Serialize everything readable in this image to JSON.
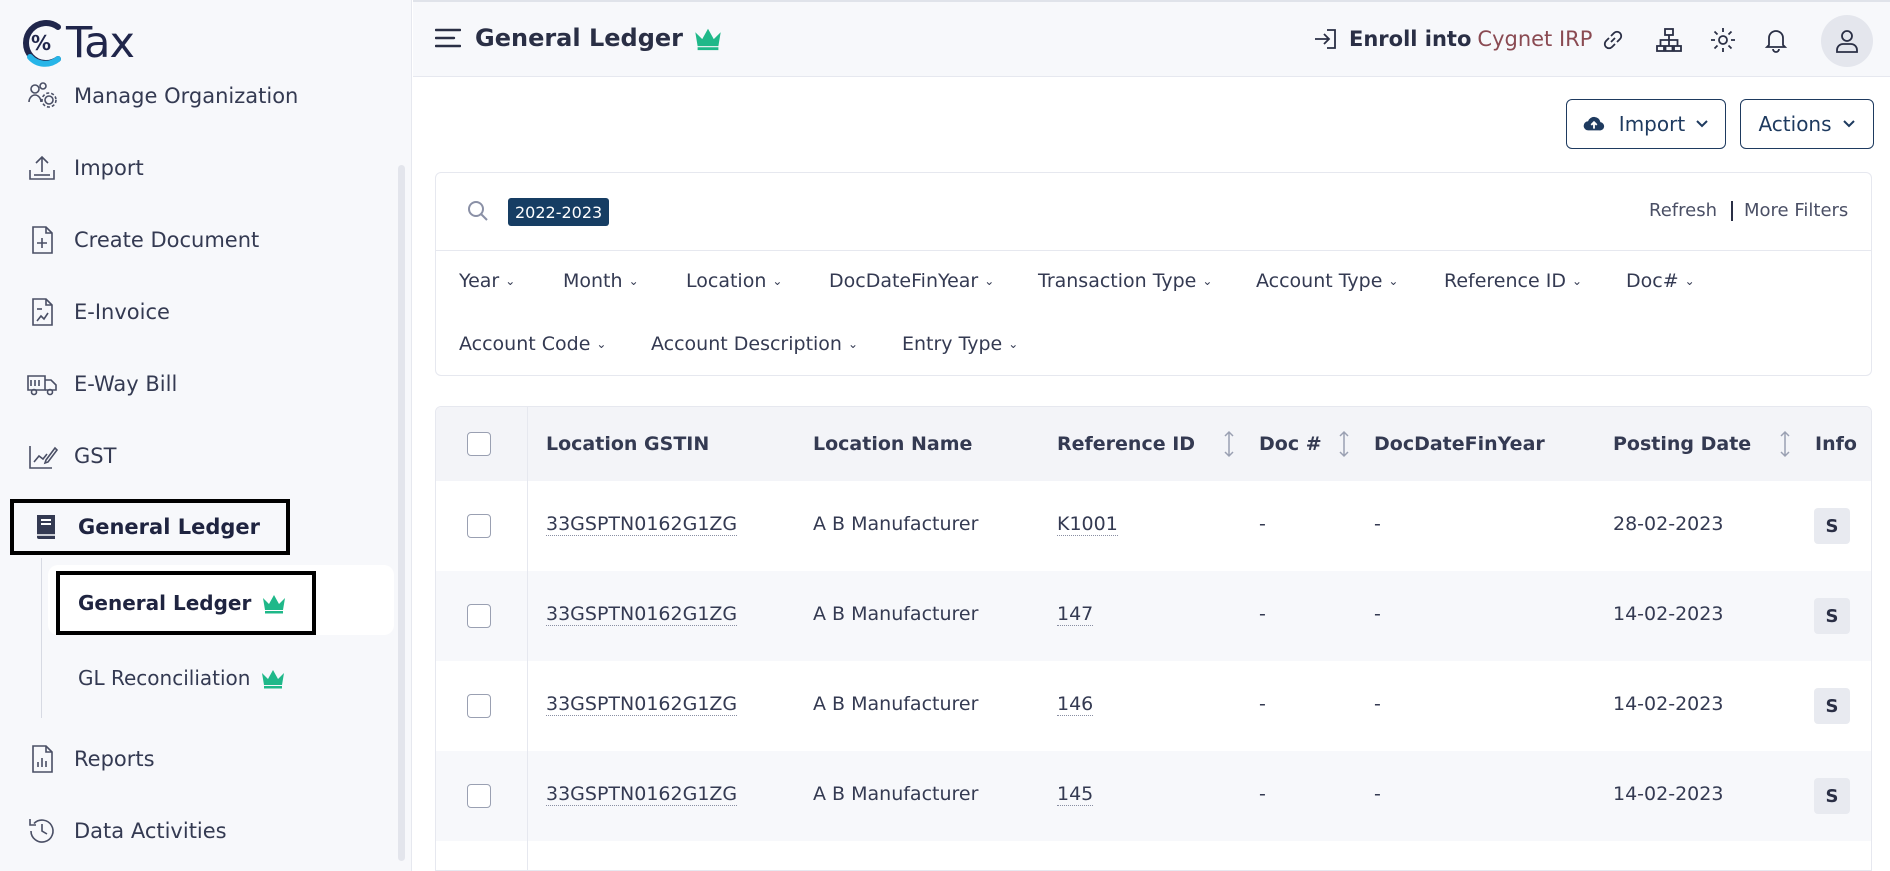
{
  "app": {
    "logo_text": "Tax"
  },
  "sidebar": {
    "items": [
      {
        "label": "Manage Organization",
        "icon": "org-gear-icon"
      },
      {
        "label": "Import",
        "icon": "upload-icon"
      },
      {
        "label": "Create Document",
        "icon": "document-plus-icon"
      },
      {
        "label": "E-Invoice",
        "icon": "invoice-icon"
      },
      {
        "label": "E-Way Bill",
        "icon": "truck-icon"
      },
      {
        "label": "GST",
        "icon": "chart-pen-icon"
      },
      {
        "label": "General Ledger",
        "icon": "book-icon"
      },
      {
        "label": "Reports",
        "icon": "report-icon"
      },
      {
        "label": "Data Activities",
        "icon": "history-icon"
      }
    ],
    "sub_items": [
      {
        "label": "General Ledger",
        "premium": true
      },
      {
        "label": "GL Reconciliation",
        "premium": true
      }
    ]
  },
  "header": {
    "title": "General Ledger",
    "enroll_label": "Enroll into",
    "enroll_brand": "Cygnet IRP"
  },
  "toolbar": {
    "import_label": "Import",
    "actions_label": "Actions"
  },
  "filters": {
    "chip": "2022-2023",
    "refresh_label": "Refresh",
    "more_label": "More Filters",
    "dropdowns": [
      "Year",
      "Month",
      "Location",
      "DocDateFinYear",
      "Transaction Type",
      "Account Type",
      "Reference ID",
      "Doc#",
      "Account Code",
      "Account Description",
      "Entry Type"
    ]
  },
  "table": {
    "columns": [
      "Location GSTIN",
      "Location Name",
      "Reference ID",
      "Doc #",
      "DocDateFinYear",
      "Posting Date",
      "Info"
    ],
    "rows": [
      {
        "gstin": "33GSPTN0162G1ZG",
        "name": "A B Manufacturer",
        "ref": "K1001",
        "doc": "-",
        "fin": "-",
        "date": "28-02-2023",
        "info": "S"
      },
      {
        "gstin": "33GSPTN0162G1ZG",
        "name": "A B Manufacturer",
        "ref": "147",
        "doc": "-",
        "fin": "-",
        "date": "14-02-2023",
        "info": "S"
      },
      {
        "gstin": "33GSPTN0162G1ZG",
        "name": "A B Manufacturer",
        "ref": "146",
        "doc": "-",
        "fin": "-",
        "date": "14-02-2023",
        "info": "S"
      },
      {
        "gstin": "33GSPTN0162G1ZG",
        "name": "A B Manufacturer",
        "ref": "145",
        "doc": "-",
        "fin": "-",
        "date": "14-02-2023",
        "info": "S"
      }
    ]
  },
  "colors": {
    "brand_navy": "#163d63",
    "crown_green": "#1fb889",
    "irp_red": "#8a4a52"
  }
}
